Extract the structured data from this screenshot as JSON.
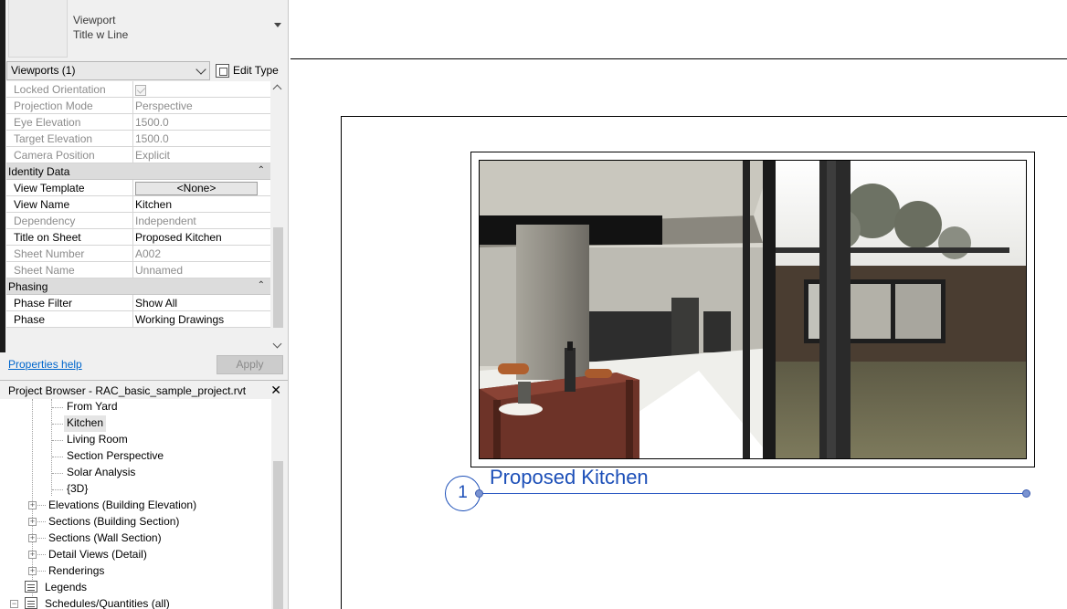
{
  "properties": {
    "type_selector": {
      "name_line1": "Viewport",
      "name_line2": "Title w Line"
    },
    "instance_filter": "Viewports (1)",
    "edit_type": "Edit Type",
    "rows_top": [
      {
        "label": "Locked Orientation",
        "value": "",
        "checkbox": true
      },
      {
        "label": "Projection Mode",
        "value": "Perspective"
      },
      {
        "label": "Eye Elevation",
        "value": "1500.0"
      },
      {
        "label": "Target Elevation",
        "value": "1500.0"
      },
      {
        "label": "Camera Position",
        "value": "Explicit"
      }
    ],
    "identity_group": "Identity Data",
    "identity_rows": [
      {
        "label": "View Template",
        "value": "<None>"
      },
      {
        "label": "View Name",
        "value": "Kitchen"
      },
      {
        "label": "Dependency",
        "value": "Independent"
      },
      {
        "label": "Title on Sheet",
        "value": "Proposed Kitchen"
      },
      {
        "label": "Sheet Number",
        "value": "A002"
      },
      {
        "label": "Sheet Name",
        "value": "Unnamed"
      }
    ],
    "phasing_group": "Phasing",
    "phasing_rows": [
      {
        "label": "Phase Filter",
        "value": "Show All"
      },
      {
        "label": "Phase",
        "value": "Working Drawings"
      }
    ],
    "help_link": "Properties help",
    "apply": "Apply"
  },
  "browser": {
    "title": "Project Browser - RAC_basic_sample_project.rvt",
    "close": "✕",
    "views": [
      "From Yard",
      "Kitchen",
      "Living Room",
      "Section Perspective",
      "Solar Analysis",
      "{3D}"
    ],
    "groups": [
      "Elevations (Building Elevation)",
      "Sections (Building Section)",
      "Sections (Wall Section)",
      "Detail Views (Detail)",
      "Renderings"
    ],
    "legends": "Legends",
    "schedules": "Schedules/Quantities (all)"
  },
  "sheet": {
    "view_title": "Proposed Kitchen",
    "view_number": "1"
  },
  "colors": {
    "title_blue": "#1c4fb8",
    "link_blue": "#0066cc"
  }
}
